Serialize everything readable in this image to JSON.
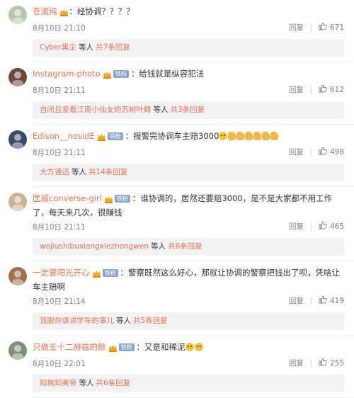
{
  "comments": [
    {
      "username": "苍波纯",
      "fan_badge": "",
      "text": "：经协调？？？？",
      "emojis": [],
      "time": "8月10日 21:10",
      "reply_label": "回复",
      "likes": "671",
      "replies": {
        "user": "Cyber黑尘",
        "mid": "等人",
        "count": "共7条回复"
      },
      "avatar_color": "#b8c6b0"
    },
    {
      "username": "Instagram-photo",
      "fan_badge": "铁粉",
      "text": "：给钱就是纵容犯法",
      "emojis": [],
      "time": "8月10日 21:11",
      "reply_label": "回复",
      "likes": "612",
      "replies": {
        "user": "自闭且爱着江南小仙女的苏树叶鲱",
        "mid": "等人",
        "count": "共3条回复"
      },
      "avatar_color": "#6b4a3c"
    },
    {
      "username": "Edison__nosidE",
      "fan_badge": "铁粉",
      "text": "：报警完协调车主赔3000",
      "emojis": [
        "face",
        "thumb",
        "thumb",
        "thumb",
        "thumb",
        "thumb",
        "thumb"
      ],
      "time": "8月10日 21:11",
      "reply_label": "回复",
      "likes": "498",
      "replies": {
        "user": "大方通迅",
        "mid": "等人",
        "count": "共14条回复"
      },
      "avatar_color": "#3a4a6a"
    },
    {
      "username": "匡威converse-girl",
      "fan_badge": "铁粉",
      "text": "：谁协调的，居然还要赔3000，是不是大家都不用工作了，每天来几次，很赚钱",
      "emojis": [],
      "time": "8月10日 21:11",
      "reply_label": "回复",
      "likes": "465",
      "replies": {
        "user": "wojiushibuxiangxiezhongwen",
        "mid": "等人",
        "count": "共8条回复"
      },
      "avatar_color": "#c9b39a"
    },
    {
      "username": "一定要阳光开心",
      "fan_badge": "铁粉",
      "text": "：警察既然这么好心，那就让协调的警察把钱出了呗，凭啥让车主赔啊",
      "emojis": [],
      "time": "8月10日 21:14",
      "reply_label": "回复",
      "likes": "419",
      "replies": {
        "user": "我跟你讲讲学车的事儿",
        "mid": "等人",
        "count": "共5条回复"
      },
      "avatar_color": "#a07050"
    },
    {
      "username": "只做五十二赫兹的鲸",
      "fan_badge": "铁粉",
      "text": "：又是和稀泥",
      "emojis": [
        "face",
        "face"
      ],
      "time": "8月10日 22:01",
      "reply_label": "回复",
      "likes": "255",
      "replies": {
        "user": "知無知美帝",
        "mid": "等人",
        "count": "共6条回复"
      },
      "avatar_color": "#7f8f7a"
    }
  ],
  "colors": {
    "username": "#eb7350",
    "meta": "#808080",
    "reply_bg": "#f2f2f5",
    "badge": "#8aa6cd"
  }
}
